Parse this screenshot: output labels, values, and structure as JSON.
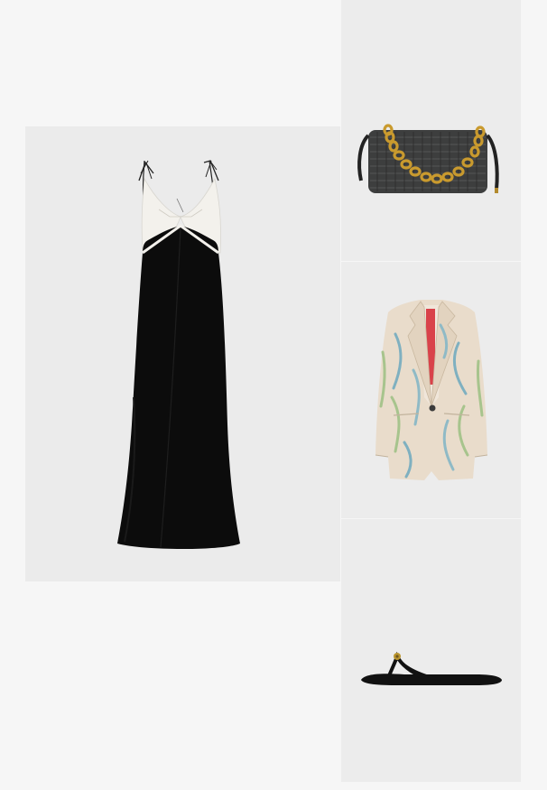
{
  "products": [
    {
      "item": "dress-icon",
      "kind": "maxi slip dress",
      "colors": {
        "body": "#0c0c0c",
        "top": "#f3f1ec"
      }
    },
    {
      "item": "handbag-icon",
      "kind": "woven shoulder bag with chain strap",
      "colors": {
        "body": "#3d3e3e",
        "chain": "#c99a2e"
      }
    },
    {
      "item": "blazer-icon",
      "kind": "printed blazer",
      "colors": {
        "base": "#e9dccb",
        "print": "#7fb0c0",
        "leaf": "#a7c48d",
        "lining": "#d9424a"
      }
    },
    {
      "item": "sandal-icon",
      "kind": "flip-flop sandal",
      "colors": {
        "body": "#111111",
        "hardware": "#b9952f"
      }
    }
  ],
  "background": {
    "page": "#f6f6f6",
    "tile": "#ebebeb"
  }
}
